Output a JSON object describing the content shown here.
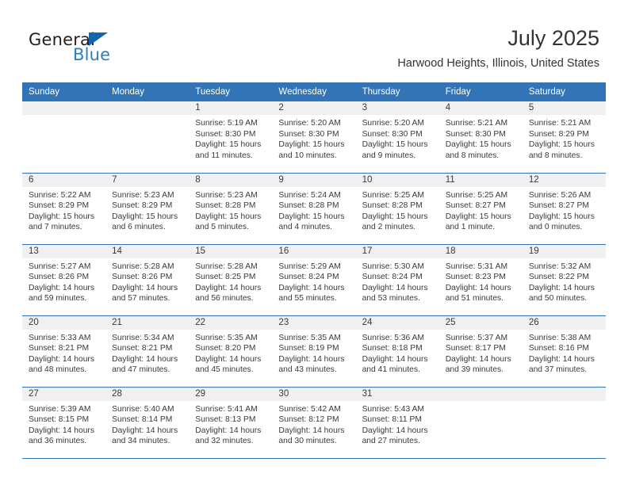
{
  "brand": {
    "word_one": "General",
    "word_two": "Blue",
    "logo_icon": "triangle-flag-icon"
  },
  "header": {
    "month_title": "July 2025",
    "location": "Harwood Heights, Illinois, United States"
  },
  "calendar": {
    "weekday_headers": [
      "Sunday",
      "Monday",
      "Tuesday",
      "Wednesday",
      "Thursday",
      "Friday",
      "Saturday"
    ],
    "labels": {
      "sunrise_prefix": "Sunrise:",
      "sunset_prefix": "Sunset:",
      "daylight_prefix": "Daylight:"
    },
    "colors": {
      "header_blue": "#3274b5",
      "band_gray": "#f0f0f0",
      "brand_blue": "#2a7fc1",
      "text": "#3a3a3a"
    },
    "weeks": [
      [
        {
          "day": "",
          "empty": true
        },
        {
          "day": "",
          "empty": true
        },
        {
          "day": "1",
          "sunrise": "Sunrise: 5:19 AM",
          "sunset": "Sunset: 8:30 PM",
          "daylight": "Daylight: 15 hours and 11 minutes."
        },
        {
          "day": "2",
          "sunrise": "Sunrise: 5:20 AM",
          "sunset": "Sunset: 8:30 PM",
          "daylight": "Daylight: 15 hours and 10 minutes."
        },
        {
          "day": "3",
          "sunrise": "Sunrise: 5:20 AM",
          "sunset": "Sunset: 8:30 PM",
          "daylight": "Daylight: 15 hours and 9 minutes."
        },
        {
          "day": "4",
          "sunrise": "Sunrise: 5:21 AM",
          "sunset": "Sunset: 8:30 PM",
          "daylight": "Daylight: 15 hours and 8 minutes."
        },
        {
          "day": "5",
          "sunrise": "Sunrise: 5:21 AM",
          "sunset": "Sunset: 8:29 PM",
          "daylight": "Daylight: 15 hours and 8 minutes."
        }
      ],
      [
        {
          "day": "6",
          "sunrise": "Sunrise: 5:22 AM",
          "sunset": "Sunset: 8:29 PM",
          "daylight": "Daylight: 15 hours and 7 minutes."
        },
        {
          "day": "7",
          "sunrise": "Sunrise: 5:23 AM",
          "sunset": "Sunset: 8:29 PM",
          "daylight": "Daylight: 15 hours and 6 minutes."
        },
        {
          "day": "8",
          "sunrise": "Sunrise: 5:23 AM",
          "sunset": "Sunset: 8:28 PM",
          "daylight": "Daylight: 15 hours and 5 minutes."
        },
        {
          "day": "9",
          "sunrise": "Sunrise: 5:24 AM",
          "sunset": "Sunset: 8:28 PM",
          "daylight": "Daylight: 15 hours and 4 minutes."
        },
        {
          "day": "10",
          "sunrise": "Sunrise: 5:25 AM",
          "sunset": "Sunset: 8:28 PM",
          "daylight": "Daylight: 15 hours and 2 minutes."
        },
        {
          "day": "11",
          "sunrise": "Sunrise: 5:25 AM",
          "sunset": "Sunset: 8:27 PM",
          "daylight": "Daylight: 15 hours and 1 minute."
        },
        {
          "day": "12",
          "sunrise": "Sunrise: 5:26 AM",
          "sunset": "Sunset: 8:27 PM",
          "daylight": "Daylight: 15 hours and 0 minutes."
        }
      ],
      [
        {
          "day": "13",
          "sunrise": "Sunrise: 5:27 AM",
          "sunset": "Sunset: 8:26 PM",
          "daylight": "Daylight: 14 hours and 59 minutes."
        },
        {
          "day": "14",
          "sunrise": "Sunrise: 5:28 AM",
          "sunset": "Sunset: 8:26 PM",
          "daylight": "Daylight: 14 hours and 57 minutes."
        },
        {
          "day": "15",
          "sunrise": "Sunrise: 5:28 AM",
          "sunset": "Sunset: 8:25 PM",
          "daylight": "Daylight: 14 hours and 56 minutes."
        },
        {
          "day": "16",
          "sunrise": "Sunrise: 5:29 AM",
          "sunset": "Sunset: 8:24 PM",
          "daylight": "Daylight: 14 hours and 55 minutes."
        },
        {
          "day": "17",
          "sunrise": "Sunrise: 5:30 AM",
          "sunset": "Sunset: 8:24 PM",
          "daylight": "Daylight: 14 hours and 53 minutes."
        },
        {
          "day": "18",
          "sunrise": "Sunrise: 5:31 AM",
          "sunset": "Sunset: 8:23 PM",
          "daylight": "Daylight: 14 hours and 51 minutes."
        },
        {
          "day": "19",
          "sunrise": "Sunrise: 5:32 AM",
          "sunset": "Sunset: 8:22 PM",
          "daylight": "Daylight: 14 hours and 50 minutes."
        }
      ],
      [
        {
          "day": "20",
          "sunrise": "Sunrise: 5:33 AM",
          "sunset": "Sunset: 8:21 PM",
          "daylight": "Daylight: 14 hours and 48 minutes."
        },
        {
          "day": "21",
          "sunrise": "Sunrise: 5:34 AM",
          "sunset": "Sunset: 8:21 PM",
          "daylight": "Daylight: 14 hours and 47 minutes."
        },
        {
          "day": "22",
          "sunrise": "Sunrise: 5:35 AM",
          "sunset": "Sunset: 8:20 PM",
          "daylight": "Daylight: 14 hours and 45 minutes."
        },
        {
          "day": "23",
          "sunrise": "Sunrise: 5:35 AM",
          "sunset": "Sunset: 8:19 PM",
          "daylight": "Daylight: 14 hours and 43 minutes."
        },
        {
          "day": "24",
          "sunrise": "Sunrise: 5:36 AM",
          "sunset": "Sunset: 8:18 PM",
          "daylight": "Daylight: 14 hours and 41 minutes."
        },
        {
          "day": "25",
          "sunrise": "Sunrise: 5:37 AM",
          "sunset": "Sunset: 8:17 PM",
          "daylight": "Daylight: 14 hours and 39 minutes."
        },
        {
          "day": "26",
          "sunrise": "Sunrise: 5:38 AM",
          "sunset": "Sunset: 8:16 PM",
          "daylight": "Daylight: 14 hours and 37 minutes."
        }
      ],
      [
        {
          "day": "27",
          "sunrise": "Sunrise: 5:39 AM",
          "sunset": "Sunset: 8:15 PM",
          "daylight": "Daylight: 14 hours and 36 minutes."
        },
        {
          "day": "28",
          "sunrise": "Sunrise: 5:40 AM",
          "sunset": "Sunset: 8:14 PM",
          "daylight": "Daylight: 14 hours and 34 minutes."
        },
        {
          "day": "29",
          "sunrise": "Sunrise: 5:41 AM",
          "sunset": "Sunset: 8:13 PM",
          "daylight": "Daylight: 14 hours and 32 minutes."
        },
        {
          "day": "30",
          "sunrise": "Sunrise: 5:42 AM",
          "sunset": "Sunset: 8:12 PM",
          "daylight": "Daylight: 14 hours and 30 minutes."
        },
        {
          "day": "31",
          "sunrise": "Sunrise: 5:43 AM",
          "sunset": "Sunset: 8:11 PM",
          "daylight": "Daylight: 14 hours and 27 minutes."
        },
        {
          "day": "",
          "empty": true
        },
        {
          "day": "",
          "empty": true
        }
      ]
    ]
  }
}
